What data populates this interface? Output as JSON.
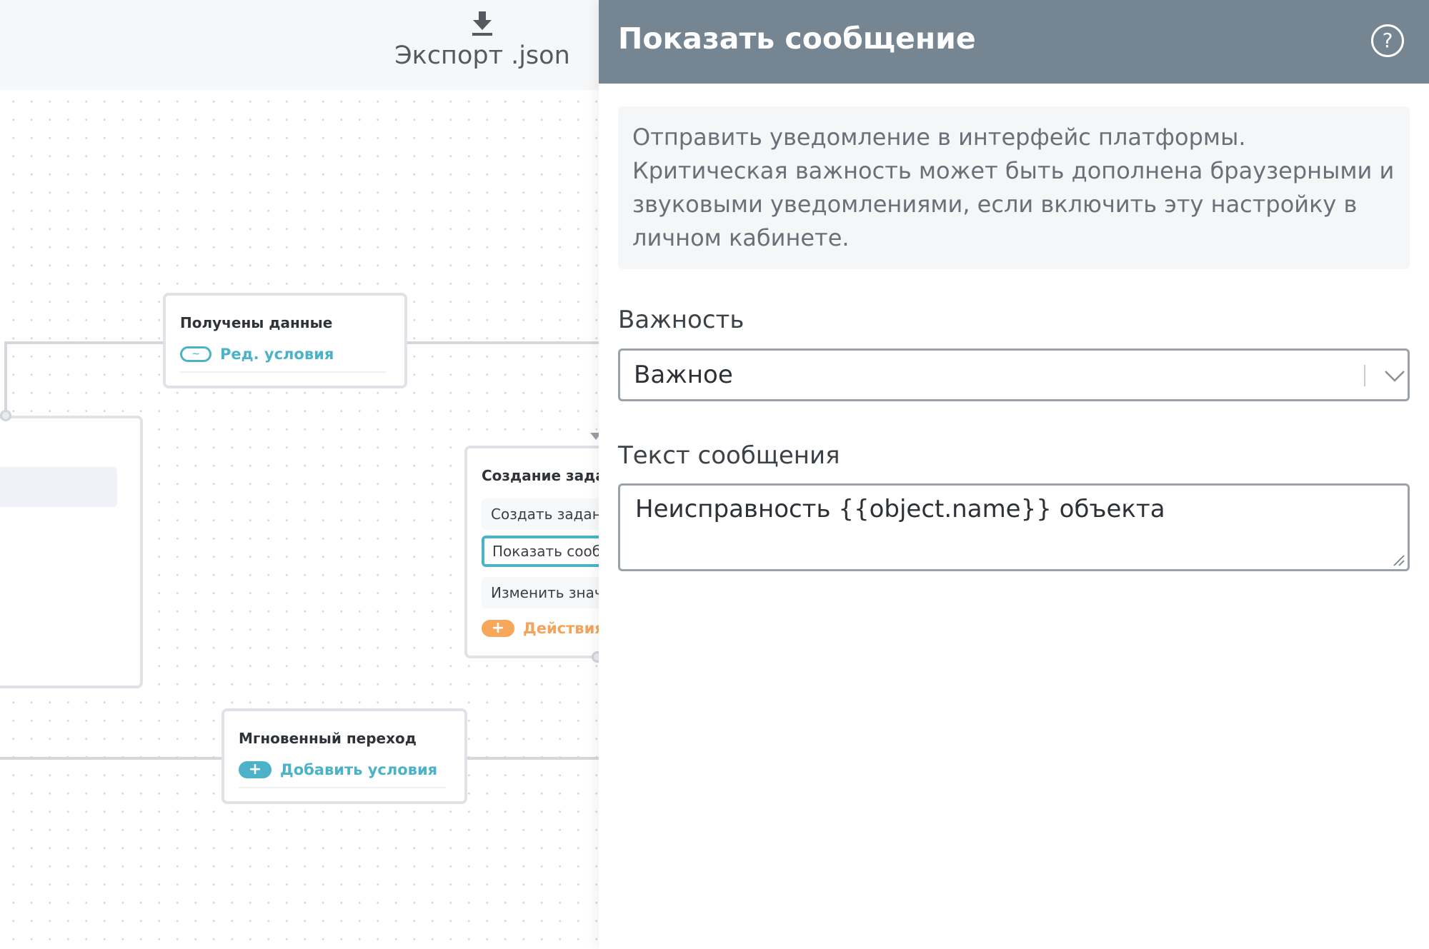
{
  "toolbar": {
    "export_label": "Экспорт .json"
  },
  "canvas": {
    "node_data_received": {
      "title": "Получены данные",
      "link_label": "Ред. условия"
    },
    "node_task_creation": {
      "title": "Создание задан",
      "actions": [
        "Создать задани",
        "Показать сооб",
        "Изменить знач"
      ],
      "add_actions_label": "Действия н"
    },
    "node_instant_transition": {
      "title": "Мгновенный переход",
      "add_conditions_label": "Добавить условия"
    }
  },
  "panel": {
    "title": "Показать сообщение",
    "help_symbol": "?",
    "description": "Отправить уведомление в интерфейс платформы. Критическая важность может быть дополнена браузерными и звуковыми уведомлениями, если включить эту настройку в личном кабинете.",
    "importance": {
      "label": "Важность",
      "value": "Важное"
    },
    "message": {
      "label": "Текст сообщения",
      "value": "Неисправность {{object.name}} объекта"
    }
  },
  "colors": {
    "accent": "#4bb2c8",
    "add_action": "#f6a75a",
    "panel_header": "#768592"
  }
}
